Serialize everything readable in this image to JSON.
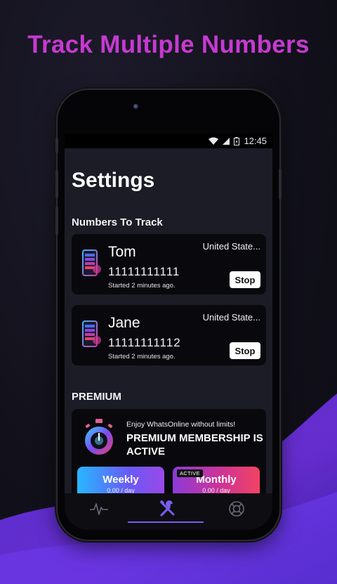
{
  "headline": "Track Multiple Numbers",
  "status_bar": {
    "time": "12:45"
  },
  "page": {
    "title": "Settings"
  },
  "numbers_section": {
    "label": "Numbers To Track",
    "items": [
      {
        "name": "Tom",
        "country": "United State...",
        "number": "11111111111",
        "started": "Started 2 minutes ago.",
        "action": "Stop"
      },
      {
        "name": "Jane",
        "country": "United State...",
        "number": "11111111112",
        "started": "Started 2 minutes ago.",
        "action": "Stop"
      }
    ]
  },
  "premium_section": {
    "label": "PREMIUM",
    "tagline": "Enjoy WhatsOnline without limits!",
    "status": "PREMIUM MEMBERSHIP IS ACTIVE",
    "plans": [
      {
        "name": "Weekly",
        "price": "0.00 / day"
      },
      {
        "name": "Monthly",
        "price": "0.00 / day",
        "badge": "ACTIVE"
      }
    ]
  },
  "bottom_nav": {
    "items": [
      {
        "icon": "activity-icon"
      },
      {
        "icon": "tools-icon",
        "active": true
      },
      {
        "icon": "lifebuoy-icon"
      }
    ]
  },
  "colors": {
    "headline": "#c63ad1",
    "accent": "#7c5cf0",
    "weekly_gradient": [
      "#27b7ff",
      "#9a49e8"
    ],
    "monthly_gradient": [
      "#8d3ad8",
      "#f24463"
    ]
  }
}
